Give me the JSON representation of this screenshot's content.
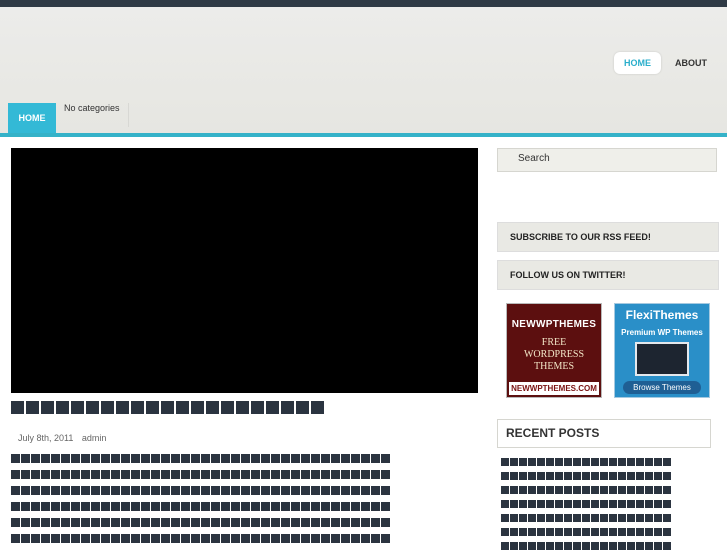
{
  "header": {
    "nav": [
      {
        "label": "HOME",
        "active": true
      },
      {
        "label": "ABOUT",
        "active": false
      }
    ],
    "catnav": {
      "home": "HOME",
      "nocat": "No categories"
    }
  },
  "post": {
    "date": "July 8th, 2011",
    "author": "admin"
  },
  "sidebar": {
    "search_placeholder": "Search",
    "rss": "SUBSCRIBE TO OUR RSS FEED!",
    "twitter": "FOLLOW US ON TWITTER!",
    "ad1": {
      "brand": "NEWWPTHEMES",
      "line1": "FREE",
      "line2": "WORDPRESS",
      "line3": "THEMES",
      "url": "NEWWPTHEMES.COM"
    },
    "ad2": {
      "brand": "FlexiThemes",
      "sub": "Premium WP Themes",
      "button": "Browse Themes"
    },
    "recent_title": "RECENT POSTS"
  },
  "colors": {
    "accent": "#35b2c8",
    "topbar": "#2f3a45",
    "ad1_bg": "#5c0f0f",
    "ad2_bg": "#2a8fc8"
  }
}
